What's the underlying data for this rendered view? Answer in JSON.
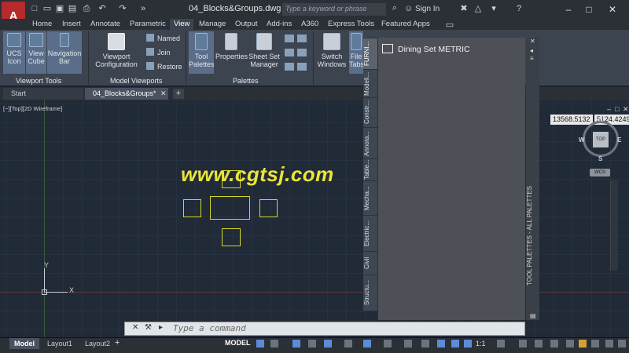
{
  "app": {
    "logo_letter": "A",
    "document_title": "04_Blocks&Groups.dwg",
    "search_placeholder": "Type a keyword or phrase",
    "signin_label": "Sign In"
  },
  "ribbon_tabs": [
    "Home",
    "Insert",
    "Annotate",
    "Parametric",
    "View",
    "Manage",
    "Output",
    "Add-ins",
    "A360",
    "Express Tools",
    "Featured Apps"
  ],
  "active_ribbon_tab": "View",
  "ribbon": {
    "viewport_tools": {
      "label": "Viewport Tools",
      "ucs_icon": "UCS Icon",
      "view_cube": "View Cube",
      "navigation_bar": "Navigation Bar"
    },
    "model_viewports": {
      "label": "Model Viewports",
      "viewport_configuration": "Viewport Configuration",
      "named": "Named",
      "join": "Join",
      "restore": "Restore"
    },
    "palettes": {
      "label": "Palettes",
      "tool_palettes": "Tool Palettes",
      "properties": "Properties",
      "sheet_set_manager": "Sheet Set Manager"
    },
    "interface": {
      "switch_windows": "Switch Windows",
      "file_tabs": "File Tabs"
    }
  },
  "doc_tabs": [
    "Start",
    "04_Blocks&Groups*"
  ],
  "viewport_label": "[−][Top][2D Wireframe]",
  "watermark": "www.cgtsj.com",
  "palette": {
    "vertical_title": "TOOL PALETTES - ALL PALETTES",
    "tabs": [
      "FURNI...",
      "Modeli...",
      "Constr...",
      "Annota...",
      "Table...",
      "Mecha...",
      "Electric...",
      "Civil",
      "Structu..."
    ],
    "active_item": "Dining Set  METRIC"
  },
  "coordinates": {
    "x": "13568.5132",
    "y": "5124.4249"
  },
  "viewcube": {
    "face": "TOP",
    "n": "N",
    "s": "S",
    "w": "W",
    "e": "E",
    "wcs": "WCS"
  },
  "ucs": {
    "x_label": "X",
    "y_label": "Y"
  },
  "command": {
    "placeholder": "Type a command"
  },
  "layout_tabs": [
    "Model",
    "Layout1",
    "Layout2"
  ],
  "status": {
    "model": "MODEL",
    "scale": "1:1"
  },
  "colors": {
    "accent": "#b52a2a",
    "block_outline": "#d4d62a",
    "watermark": "#e9e53a"
  }
}
